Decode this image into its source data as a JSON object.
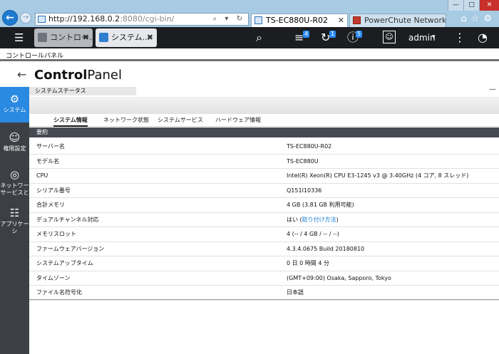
{
  "browser": {
    "url_host": "http://192.168.0.2",
    "url_rest": ":8080/cgi-bin/",
    "address_tools": "⌕ ▾ ↻",
    "back_glyph": "←",
    "forward_glyph": "→",
    "tabs": [
      {
        "title": "TS-EC880U-R02",
        "close": "✕"
      },
      {
        "title": "PowerChute Network Shut..."
      }
    ],
    "window_controls": {
      "minimize": "—",
      "maximize": "□",
      "close": "✕"
    },
    "toolbar_icons": {
      "home": "⌂",
      "favorites": "☆",
      "settings": "⚙"
    }
  },
  "qnap_bar": {
    "menu_glyph": "☰",
    "app_tabs": [
      {
        "label": "コントロー...",
        "close": "✖"
      },
      {
        "label": "システム...",
        "close": "✖"
      }
    ],
    "icons": {
      "search": "⌕",
      "tasks": "≡",
      "events": "↻",
      "info": "ⓘ",
      "user": "☺",
      "more": "⋮",
      "dashboard": "◔"
    },
    "badges": {
      "tasks": "4",
      "events": "1",
      "info": "5"
    },
    "user": "admin",
    "caret": "▾"
  },
  "breadcrumb": "コントロールパネル",
  "header": {
    "back_glyph": "←",
    "title_bold": "Control",
    "title_light": "Panel"
  },
  "sidebar": [
    {
      "label": "システム",
      "icon": "⚙"
    },
    {
      "label": "権限設定",
      "icon": "☺"
    },
    {
      "label": "ネットワークとファイルサービス",
      "line1": "ネットワー",
      "line2": "サービスと",
      "icon": "◎"
    },
    {
      "label": "アプリケーション",
      "line1": "アプリケー",
      "line2": "シ",
      "icon": "☷"
    }
  ],
  "panel": {
    "section_title": "システムステータス",
    "minimize": "—",
    "tabs": [
      "システム情報",
      "ネットワーク状態",
      "システムサービス",
      "ハードウェア情報"
    ],
    "summary_header": "要約",
    "rows": [
      {
        "key": "サーバー名",
        "value": "TS-EC880U-R02"
      },
      {
        "key": "モデル名",
        "value": "TS-EC880U"
      },
      {
        "key": "CPU",
        "value": "Intel(R) Xeon(R) CPU E3-1245 v3 @ 3.40GHz (4 コア, 8 スレッド)"
      },
      {
        "key": "シリアル番号",
        "value": "Q151I10336"
      },
      {
        "key": "合計メモリ",
        "value": "4 GB (3.81 GB 利用可能)"
      },
      {
        "key": "デュアルチャンネル対応",
        "value": "はい (",
        "link": "取り付け方法",
        "value_after": ")"
      },
      {
        "key": "メモリスロット",
        "value": "4 (-- / 4 GB / -- / --)"
      },
      {
        "key": "ファームウェアバージョン",
        "value": "4.3.4.0675 Build 20180810"
      },
      {
        "key": "システムアップタイム",
        "value": "0 日 0 時間 4 分"
      },
      {
        "key": "タイムゾーン",
        "value": "(GMT+09:00) Osaka, Sapporo, Tokyo"
      },
      {
        "key": "ファイル名符号化",
        "value": "日本語"
      }
    ]
  }
}
